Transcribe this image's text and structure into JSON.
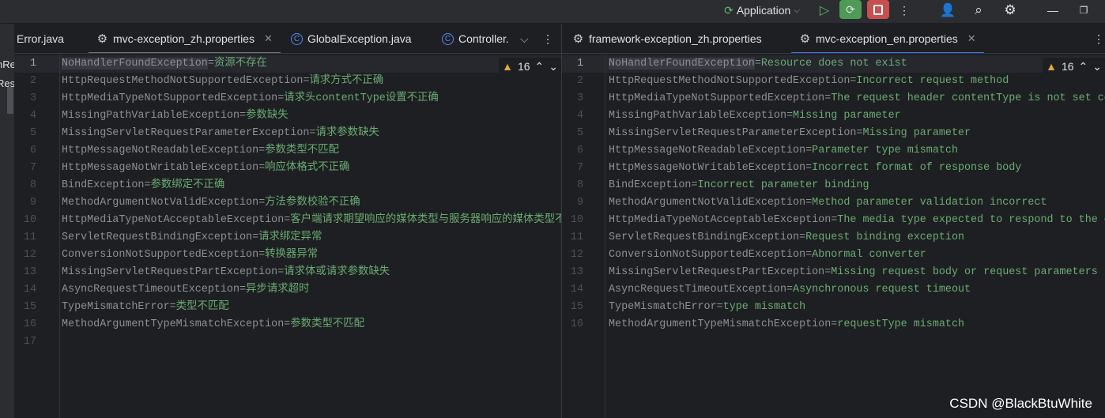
{
  "toolbar": {
    "run_config": "Application",
    "icons": [
      "run-config-icon",
      "chevron-down-icon",
      "run-icon",
      "debug-icon",
      "stop-icon",
      "more-icon",
      "add-user-icon",
      "search-icon",
      "settings-icon",
      "minimize-icon",
      "restore-icon"
    ]
  },
  "left_strip": {
    "items": [
      "nRe",
      "Res"
    ]
  },
  "left_tabs": [
    {
      "label": "Error.java",
      "icon": "java-class-icon"
    },
    {
      "label": "mvc-exception_zh.properties",
      "icon": "properties-gear-icon",
      "active": true
    },
    {
      "label": "GlobalException.java",
      "icon": "class-c-icon"
    },
    {
      "label": "Controller.",
      "icon": "class-c-icon"
    }
  ],
  "right_tabs": [
    {
      "label": "framework-exception_zh.properties",
      "icon": "properties-gear-icon"
    },
    {
      "label": "mvc-exception_en.properties",
      "icon": "properties-gear-icon",
      "active": true
    }
  ],
  "warnings_count": "16",
  "left_lines": [
    {
      "k": "NoHandlerFoundException",
      "v": "资源不存在"
    },
    {
      "k": "HttpRequestMethodNotSupportedException",
      "v": "请求方式不正确"
    },
    {
      "k": "HttpMediaTypeNotSupportedException",
      "v": "请求头contentType设置不正确"
    },
    {
      "k": "MissingPathVariableException",
      "v": "参数缺失"
    },
    {
      "k": "MissingServletRequestParameterException",
      "v": "请求参数缺失"
    },
    {
      "k": "HttpMessageNotReadableException",
      "v": "参数类型不匹配"
    },
    {
      "k": "HttpMessageNotWritableException",
      "v": "响应体格式不正确"
    },
    {
      "k": "BindException",
      "v": "参数绑定不正确"
    },
    {
      "k": "MethodArgumentNotValidException",
      "v": "方法参数校验不正确"
    },
    {
      "k": "HttpMediaTypeNotAcceptableException",
      "v": "客户端请求期望响应的媒体类型与服务器响应的媒体类型不一"
    },
    {
      "k": "ServletRequestBindingException",
      "v": "请求绑定异常"
    },
    {
      "k": "ConversionNotSupportedException",
      "v": "转换器异常"
    },
    {
      "k": "MissingServletRequestPartException",
      "v": "请求体或请求参数缺失"
    },
    {
      "k": "AsyncRequestTimeoutException",
      "v": "异步请求超时"
    },
    {
      "k": "TypeMismatchError",
      "v": "类型不匹配"
    },
    {
      "k": "MethodArgumentTypeMismatchException",
      "v": "参数类型不匹配"
    },
    {
      "k": "",
      "v": ""
    }
  ],
  "right_lines": [
    {
      "k": "NoHandlerFoundException",
      "v": "Resource does not exist"
    },
    {
      "k": "HttpRequestMethodNotSupportedException",
      "v": "Incorrect request method"
    },
    {
      "k": "HttpMediaTypeNotSupportedException",
      "v": "The request header contentType is not set co"
    },
    {
      "k": "MissingPathVariableException",
      "v": "Missing parameter"
    },
    {
      "k": "MissingServletRequestParameterException",
      "v": "Missing parameter"
    },
    {
      "k": "HttpMessageNotReadableException",
      "v": "Parameter type mismatch"
    },
    {
      "k": "HttpMessageNotWritableException",
      "v": "Incorrect format of response body"
    },
    {
      "k": "BindException",
      "v": "Incorrect parameter binding"
    },
    {
      "k": "MethodArgumentNotValidException",
      "v": "Method parameter validation incorrect"
    },
    {
      "k": "HttpMediaTypeNotAcceptableException",
      "v": "The media type expected to respond to the c"
    },
    {
      "k": "ServletRequestBindingException",
      "v": "Request binding exception"
    },
    {
      "k": "ConversionNotSupportedException",
      "v": "Abnormal converter"
    },
    {
      "k": "MissingServletRequestPartException",
      "v": "Missing request body or request parameters"
    },
    {
      "k": "AsyncRequestTimeoutException",
      "v": "Asynchronous request timeout"
    },
    {
      "k": "TypeMismatchError",
      "v": "type mismatch"
    },
    {
      "k": "MethodArgumentTypeMismatchException",
      "v": "requestType mismatch"
    }
  ],
  "watermark": "CSDN @BlackBtuWhite",
  "colors": {
    "key": "#8c8f94",
    "value": "#6aab73",
    "accent": "#3574f0",
    "debug": "#4e9a56",
    "stop": "#c94f4f"
  }
}
